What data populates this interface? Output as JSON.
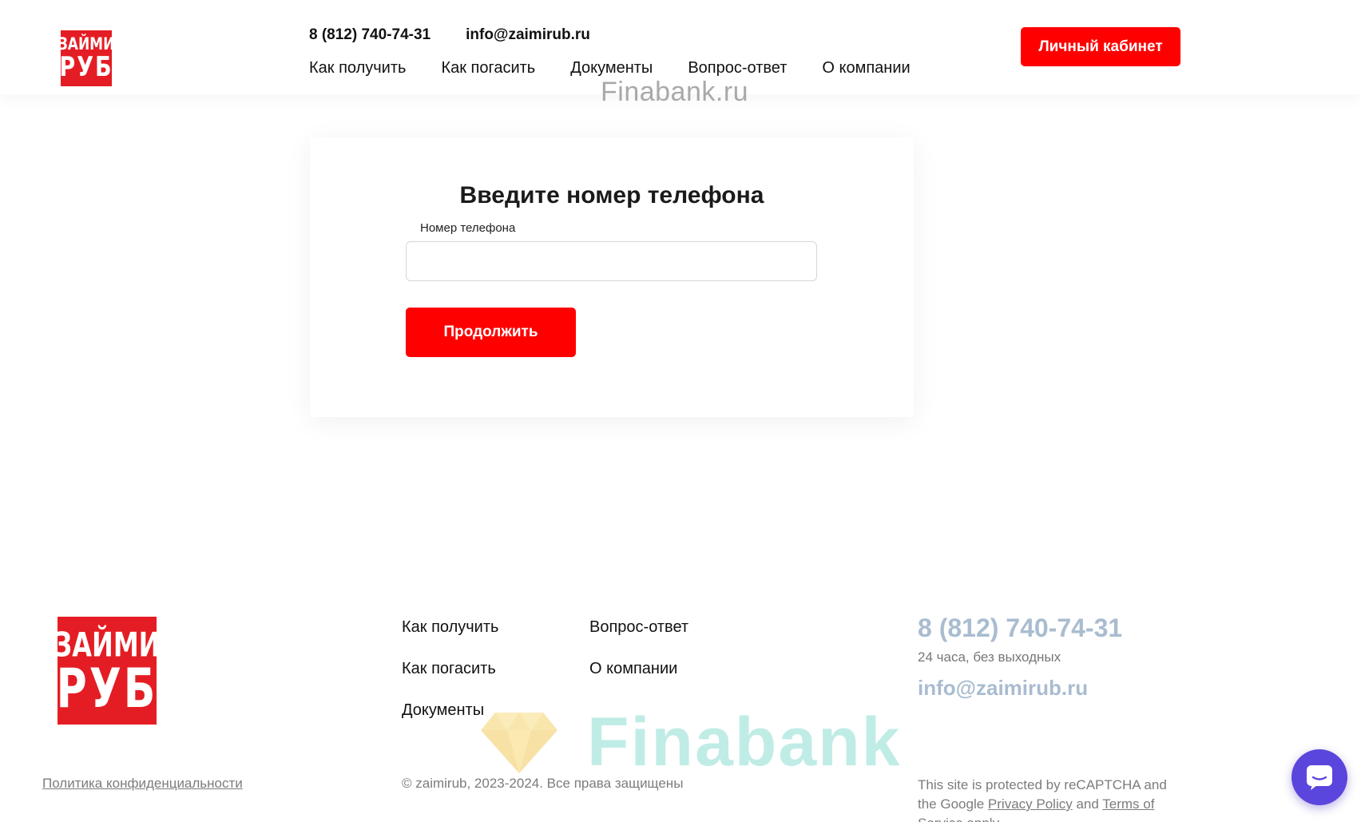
{
  "header": {
    "logo_line1": "ЗАЙМИ",
    "logo_line2": "РУБ",
    "phone": "8 (812) 740-74-31",
    "email": "info@zaimirub.ru",
    "nav": [
      "Как получить",
      "Как погасить",
      "Документы",
      "Вопрос-ответ",
      "О компании"
    ],
    "cabinet_button": "Личный кабинет"
  },
  "watermark": {
    "top": "Finabank.ru",
    "bottom": "Finabank"
  },
  "form": {
    "title": "Введите номер телефона",
    "phone_label": "Номер телефона",
    "phone_value": "",
    "continue_button": "Продолжить"
  },
  "footer": {
    "logo_line1": "ЗАЙМИ",
    "logo_line2": "РУБ",
    "nav_col1": [
      "Как получить",
      "Как погасить",
      "Документы"
    ],
    "nav_col2": [
      "Вопрос-ответ",
      "О компании"
    ],
    "phone": "8 (812) 740-74-31",
    "hours": "24 часа, без выходных",
    "email": "info@zaimirub.ru",
    "privacy_link": "Политика конфиденциальности",
    "copyright": "© zaimirub, 2023-2024. Все права защищены",
    "recaptcha_text1": "This site is protected by reCAPTCHA and the Google",
    "recaptcha_privacy": "Privacy Policy",
    "recaptcha_and": "and",
    "recaptcha_terms": "Terms of Service",
    "recaptcha_apply": "apply."
  },
  "colors": {
    "brand_red": "#e41d24",
    "button_red": "#ff0000",
    "contact_blue": "#a9bcd0",
    "chat_purple": "#5a46dd"
  },
  "icons": [
    "chat-icon",
    "diamond-icon"
  ]
}
